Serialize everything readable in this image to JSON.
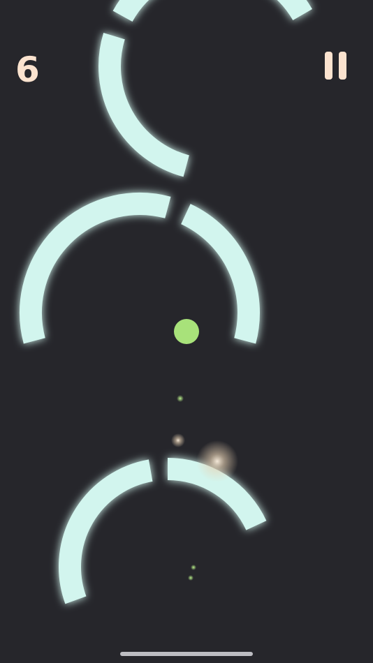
{
  "hud": {
    "score": "6",
    "pause_icon": "pause-icon"
  },
  "colors": {
    "background": "#26262b",
    "ring": "#d2f5ee",
    "player": "#a8e27a",
    "hud": "#fbe3cf",
    "spark": "#f2dfc6"
  },
  "rings": [
    {
      "name": "ring-top",
      "arcs": [
        [
          105,
          197
        ],
        [
          209,
          330
        ]
      ]
    },
    {
      "name": "ring-middle",
      "arcs": [
        [
          165,
          285
        ],
        [
          295,
          375
        ]
      ]
    },
    {
      "name": "ring-bottom",
      "arcs": [
        [
          160,
          260
        ],
        [
          270,
          335
        ]
      ]
    }
  ]
}
